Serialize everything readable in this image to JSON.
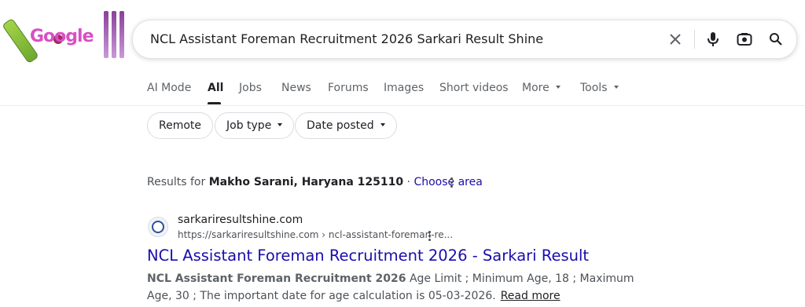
{
  "logo": {
    "text": "Google"
  },
  "search": {
    "query": "NCL Assistant Foreman Recruitment 2026 Sarkari Result Shine"
  },
  "tabs": [
    {
      "label": "AI Mode"
    },
    {
      "label": "All"
    },
    {
      "label": "Jobs"
    },
    {
      "label": "News"
    },
    {
      "label": "Forums"
    },
    {
      "label": "Images"
    },
    {
      "label": "Short videos"
    },
    {
      "label": "More"
    },
    {
      "label": "Tools"
    }
  ],
  "chips": [
    {
      "label": "Remote"
    },
    {
      "label": "Job type"
    },
    {
      "label": "Date posted"
    }
  ],
  "location": {
    "prefix": "Results for",
    "place": "Makho Sarani, Haryana 125110",
    "separator": "·",
    "link": "Choose area"
  },
  "result": {
    "site_name": "sarkariresultshine.com",
    "url": "https://sarkariresultshine.com › ncl-assistant-foreman-re...",
    "title": "NCL Assistant Foreman Recruitment 2026 - Sarkari Result",
    "snippet_bold": "NCL Assistant Foreman Recruitment 2026",
    "snippet_rest": " Age Limit ; Minimum Age, 18 ; Maximum Age, 30 ; The important date for age calculation is 05-03-2026.",
    "read_more": "Read more"
  },
  "colors": {
    "link": "#1a0dab",
    "text": "#202124",
    "muted": "#4d5156",
    "logo": "#d94fc4"
  }
}
